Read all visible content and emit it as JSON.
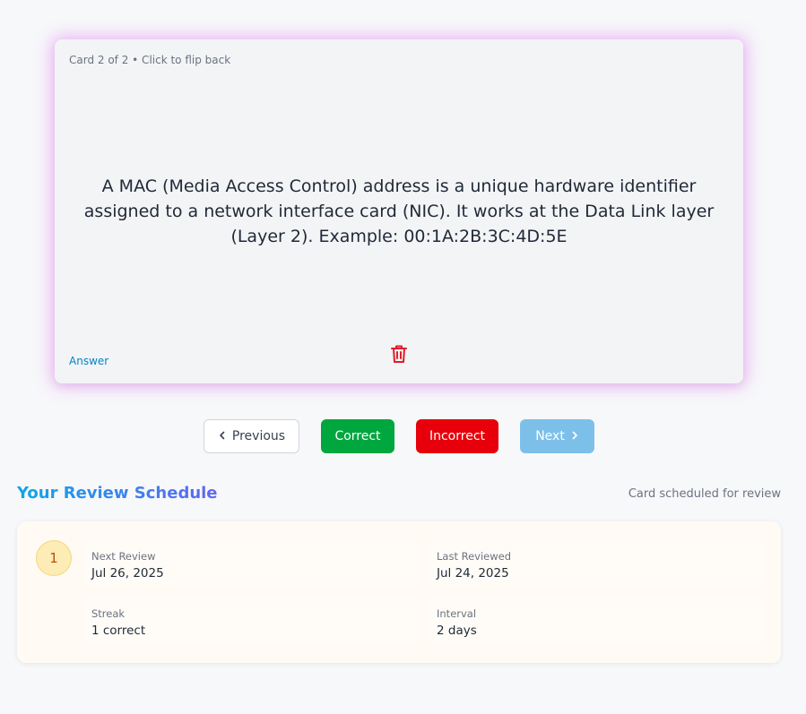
{
  "card": {
    "meta": "Card 2 of 2 • Click to flip back",
    "text": "A MAC (Media Access Control) address is a unique hardware identifier assigned to a network interface card (NIC). It works at the Data Link layer (Layer 2). Example: 00:1A:2B:3C:4D:5E",
    "side_label": "Answer",
    "delete_icon": "trash-icon",
    "delete_color": "#e11d2a"
  },
  "controls": {
    "previous_label": "Previous",
    "correct_label": "Correct",
    "incorrect_label": "Incorrect",
    "next_label": "Next"
  },
  "schedule": {
    "title": "Your Review Schedule",
    "status": "Card scheduled for review",
    "level": "1",
    "stats": [
      {
        "label": "Next Review",
        "value": "Jul 26, 2025"
      },
      {
        "label": "Last Reviewed",
        "value": "Jul 24, 2025"
      },
      {
        "label": "Streak",
        "value": "1 correct"
      },
      {
        "label": "Interval",
        "value": "2 days"
      }
    ]
  },
  "colors": {
    "correct": "#00a63e",
    "incorrect": "#e7000b",
    "next_disabled": "#7cc0ea",
    "card_glow": "#d946ef"
  }
}
